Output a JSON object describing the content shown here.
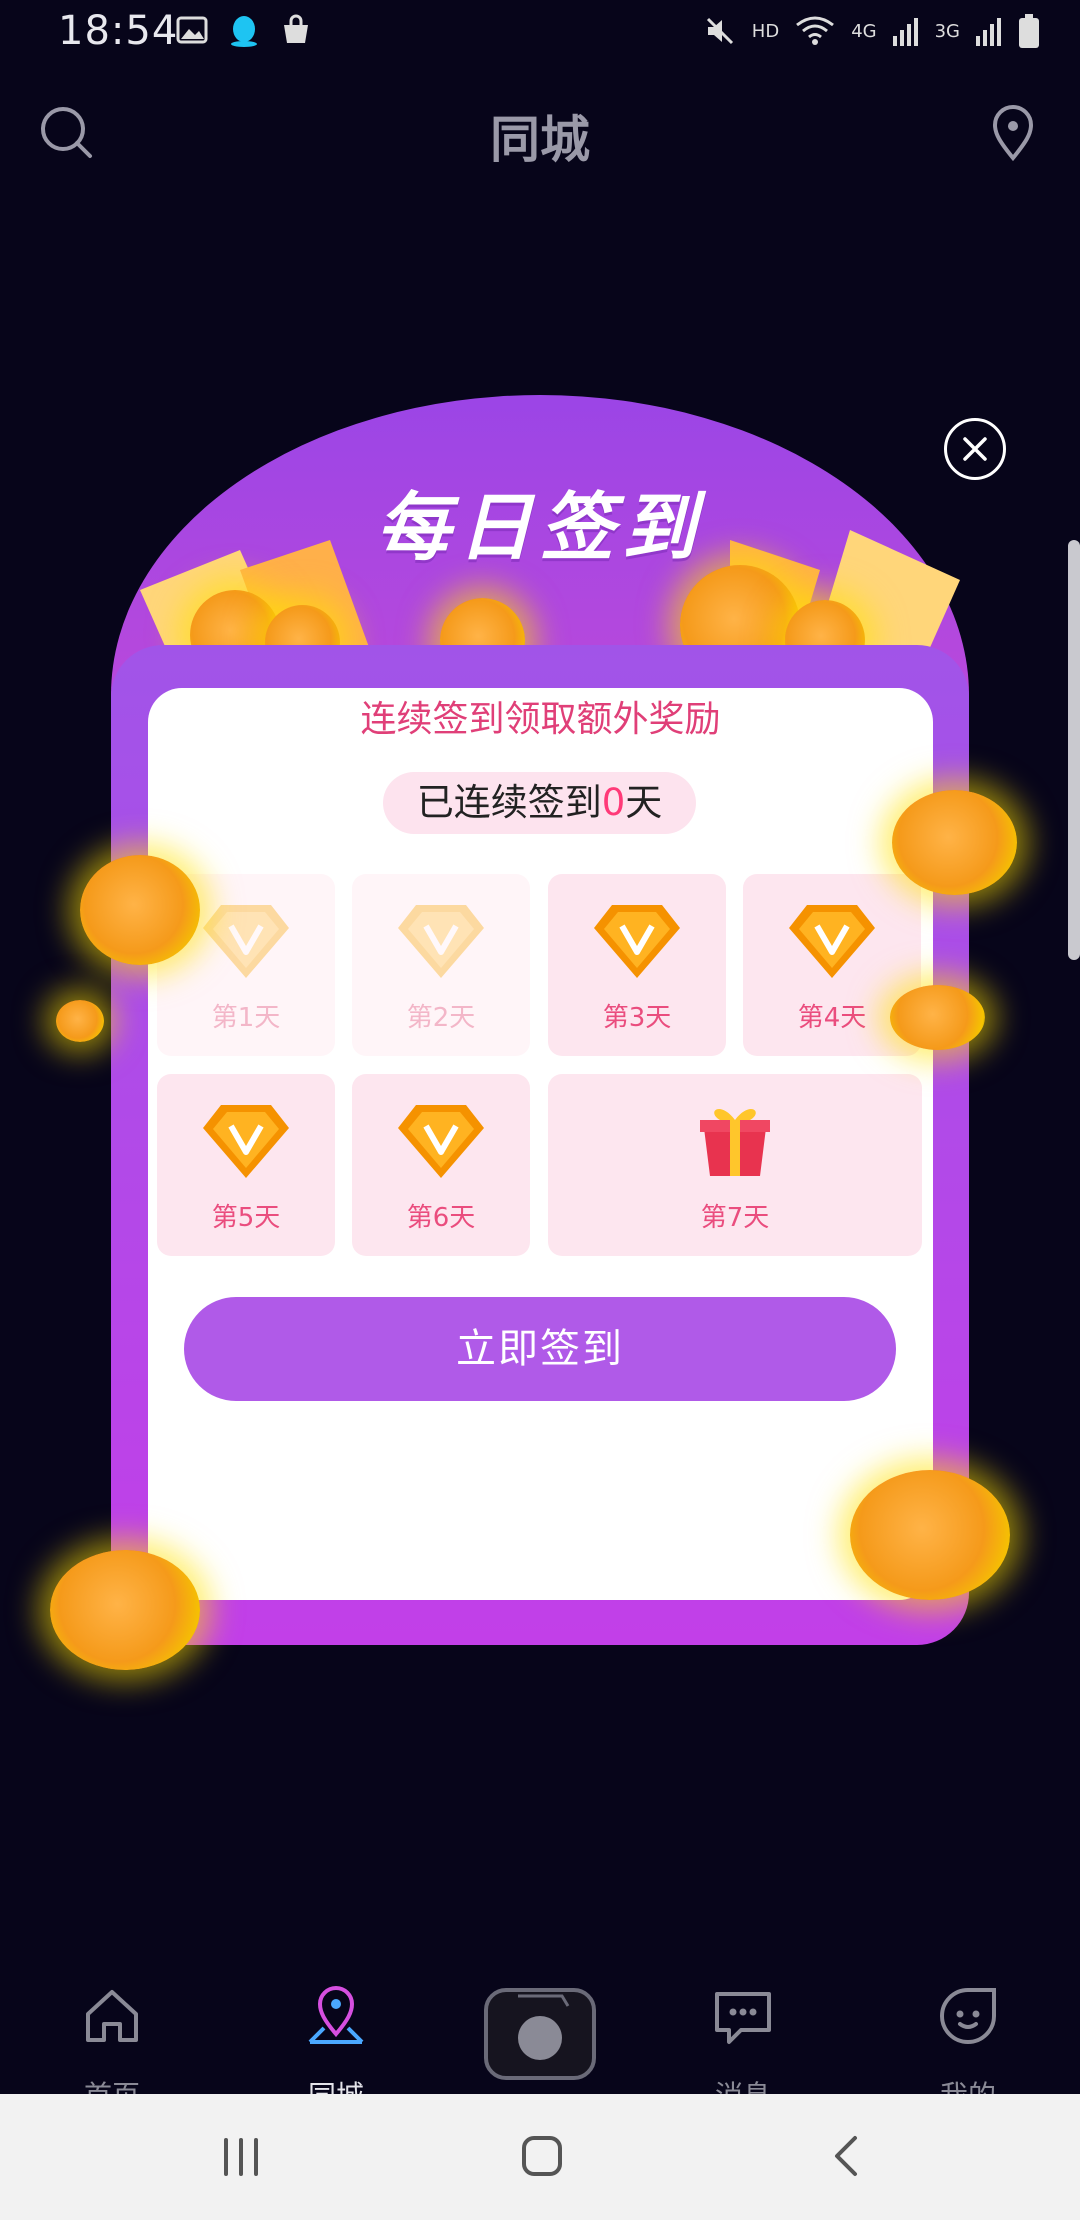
{
  "status_bar": {
    "time": "18:54",
    "hd": "HD",
    "net1": "4G",
    "net2": "3G"
  },
  "header": {
    "title": "同城"
  },
  "modal": {
    "title": "每日签到",
    "subtitle": "连续签到领取额外奖励",
    "streak_prefix": "已连续签到",
    "streak_count": "0",
    "streak_suffix": "天",
    "days": [
      {
        "label": "第1天",
        "icon": "diamond-v-icon",
        "state": "faded"
      },
      {
        "label": "第2天",
        "icon": "diamond-v-icon",
        "state": "faded"
      },
      {
        "label": "第3天",
        "icon": "diamond-v-icon",
        "state": "active"
      },
      {
        "label": "第4天",
        "icon": "diamond-v-icon",
        "state": "active"
      },
      {
        "label": "第5天",
        "icon": "diamond-v-icon",
        "state": "active"
      },
      {
        "label": "第6天",
        "icon": "diamond-v-icon",
        "state": "active"
      },
      {
        "label": "第7天",
        "icon": "gift-box-icon",
        "state": "active"
      }
    ],
    "button_label": "立即签到"
  },
  "bottom_nav": {
    "items": [
      {
        "label": "首页",
        "icon": "home-icon"
      },
      {
        "label": "同城",
        "icon": "map-pin-icon"
      },
      {
        "label": "",
        "icon": "camera-icon"
      },
      {
        "label": "消息",
        "icon": "message-icon"
      },
      {
        "label": "我的",
        "icon": "profile-icon"
      }
    ]
  },
  "colors": {
    "background": "#07051a",
    "accent": "#b05ae8",
    "pink_text": "#e03f78",
    "coin": "#f5a623"
  }
}
